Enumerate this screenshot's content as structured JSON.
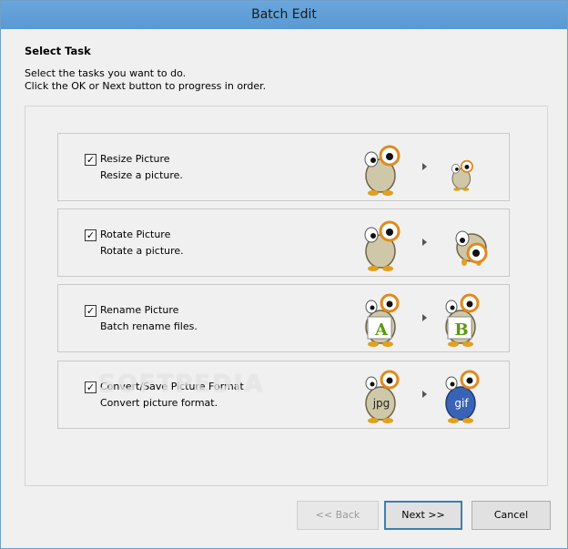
{
  "window": {
    "title": "Batch Edit"
  },
  "header": {
    "heading": "Select Task",
    "line1": "Select the tasks you want to do.",
    "line2": "Click the OK or Next button to progress in order."
  },
  "tasks": [
    {
      "title": "Resize Picture",
      "desc": "Resize a picture.",
      "checked": true,
      "before_icon": "mascot-icon",
      "after_icon": "mascot-small-icon"
    },
    {
      "title": "Rotate Picture",
      "desc": "Rotate a picture.",
      "checked": true,
      "before_icon": "mascot-icon",
      "after_icon": "mascot-rotated-icon"
    },
    {
      "title": "Rename Picture",
      "desc": "Batch rename files.",
      "checked": true,
      "before_icon": "mascot-A-icon",
      "after_icon": "mascot-B-icon",
      "before_letter": "A",
      "after_letter": "B"
    },
    {
      "title": "Convert/Save Picture Format",
      "desc": "Convert picture format.",
      "checked": true,
      "before_icon": "mascot-jpg-icon",
      "after_icon": "mascot-gif-icon",
      "before_letter": "jpg",
      "after_letter": "gif"
    }
  ],
  "buttons": {
    "back": "<< Back",
    "next": "Next >>",
    "cancel": "Cancel"
  },
  "watermark": "SOFTPEDIA",
  "colors": {
    "title_bar": "#5b9bd5",
    "window_bg": "#f0f0f0",
    "mascot_body": "#cfc8a8",
    "magnifier": "#e08a1e",
    "letter_green": "#5a9a10",
    "gif_blue": "#3a63b8"
  }
}
